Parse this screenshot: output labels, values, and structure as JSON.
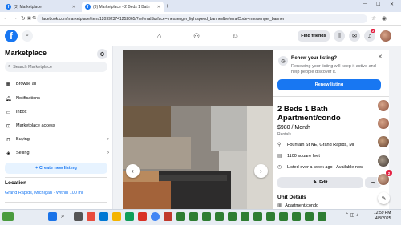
{
  "browser": {
    "tabs": [
      {
        "label": "(3) Marketplace"
      },
      {
        "label": "(3) Marketplace - 2 Beds 1 Bath"
      }
    ],
    "url": "facebook.com/marketplace/item/1203923741252065/?referralSurface=messenger_lightspeed_banner&referralCode=messenger_banner",
    "tab_count_badge": "41"
  },
  "topbar": {
    "logo": "f",
    "find_friends": "Find friends",
    "notif_count": "2"
  },
  "sidebar": {
    "title": "Marketplace",
    "search_placeholder": "Search Marketplace",
    "items": [
      {
        "label": "Browse all",
        "icon": "store-icon"
      },
      {
        "label": "Notifications",
        "icon": "bell-icon"
      },
      {
        "label": "Inbox",
        "icon": "inbox-icon"
      },
      {
        "label": "Marketplace access",
        "icon": "access-icon"
      },
      {
        "label": "Buying",
        "icon": "bag-icon"
      },
      {
        "label": "Selling",
        "icon": "tag-icon"
      }
    ],
    "create_label": "+ Create new listing",
    "location_title": "Location",
    "location_value": "Grand Rapids, Michigan · Within 100 mi"
  },
  "listing": {
    "renew_title": "Renew your listing?",
    "renew_text": "Renewing your listing will keep it active and help people discover it.",
    "renew_button": "Renew listing",
    "title": "2 Beds 1 Bath Apartment/condo",
    "price": "$980 / Month",
    "category": "Rentals",
    "address": "Fountain St NE, Grand Rapids, MI",
    "size": "1100 square feet",
    "listed": "Listed over a week ago · Available now",
    "edit_label": "Edit",
    "unit_details_title": "Unit Details",
    "unit_type": "Apartment/condo"
  },
  "chat": {
    "badge": "2"
  },
  "taskbar": {
    "time": "12:59 PM",
    "date": "4/8/2025"
  }
}
